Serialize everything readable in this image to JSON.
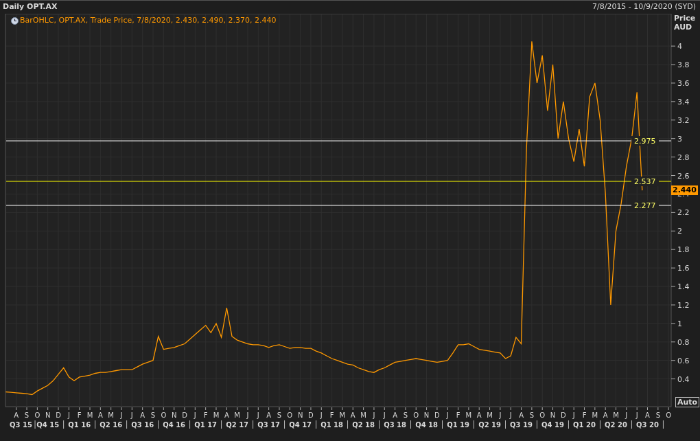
{
  "window": {
    "title": "Daily OPT.AX",
    "date_range": "7/8/2015 - 10/9/2020 (SYD)"
  },
  "legend": {
    "text": "BarOHLC, OPT.AX, Trade Price, 7/8/2020, 2.430, 2.490, 2.370, 2.440"
  },
  "chart": {
    "currency": "AUD",
    "auto_button": "Auto",
    "quarter_labels": [
      "Q3 15",
      "Q4 15",
      "Q1 16",
      "Q2 16",
      "Q3 16",
      "Q4 16",
      "Q1 17",
      "Q2 17",
      "Q3 17",
      "Q4 17",
      "Q1 18",
      "Q2 18",
      "Q3 18",
      "Q4 18",
      "Q1 19",
      "Q2 19",
      "Q3 19",
      "Q4 19",
      "Q1 20",
      "Q2 20",
      "Q3 20"
    ],
    "last_price_tag": "2.440",
    "chart_data": {
      "type": "line",
      "ylabel": "Price",
      "ylim": [
        0.1,
        4.35
      ],
      "yticks": [
        0.4,
        0.6,
        0.8,
        1,
        1.2,
        1.4,
        1.6,
        1.8,
        2,
        2.2,
        2.4,
        2.6,
        2.8,
        3,
        3.2,
        3.4,
        3.6,
        3.8,
        4
      ],
      "categories": [
        null,
        null,
        "A",
        null,
        "S",
        null,
        "O",
        null,
        "N",
        null,
        "D",
        null,
        "J",
        null,
        "F",
        null,
        "M",
        null,
        "A",
        null,
        "M",
        null,
        "J",
        null,
        "J",
        null,
        "A",
        null,
        "S",
        null,
        "O",
        null,
        "N",
        null,
        "D",
        null,
        "J",
        null,
        "F",
        null,
        "M",
        null,
        "A",
        null,
        "M",
        null,
        "J",
        null,
        "J",
        null,
        "A",
        null,
        "S",
        null,
        "O",
        null,
        "N",
        null,
        "D",
        null,
        "J",
        null,
        "F",
        null,
        "M",
        null,
        "A",
        null,
        "M",
        null,
        "J",
        null,
        "J",
        null,
        "A",
        null,
        "S",
        null,
        "O",
        null,
        "N",
        null,
        "D",
        null,
        "J",
        null,
        "F",
        null,
        "M",
        null,
        "A",
        null,
        "M",
        null,
        "J",
        null,
        "J",
        null,
        "A",
        null,
        "S",
        null,
        "O",
        null,
        "N",
        null,
        "D",
        null,
        "J",
        null,
        "F",
        null,
        "M",
        null,
        "A",
        null,
        "M",
        null,
        "J",
        null,
        "J",
        null,
        "A",
        null,
        "S",
        null,
        "O"
      ],
      "series": [
        {
          "color": "#ff9900",
          "values": [
            0.26,
            0.255,
            0.25,
            0.245,
            0.24,
            0.23,
            0.27,
            0.3,
            0.33,
            0.38,
            0.45,
            0.52,
            0.42,
            0.38,
            0.42,
            0.43,
            0.44,
            0.46,
            0.47,
            0.47,
            0.48,
            0.49,
            0.5,
            0.5,
            0.5,
            0.53,
            0.56,
            0.58,
            0.6,
            0.86,
            0.72,
            0.73,
            0.74,
            0.76,
            0.78,
            0.83,
            0.88,
            0.93,
            0.98,
            0.9,
            1.0,
            0.85,
            1.17,
            0.86,
            0.82,
            0.8,
            0.78,
            0.77,
            0.77,
            0.76,
            0.74,
            0.76,
            0.77,
            0.75,
            0.73,
            0.74,
            0.74,
            0.73,
            0.73,
            0.7,
            0.68,
            0.65,
            0.62,
            0.6,
            0.58,
            0.56,
            0.55,
            0.52,
            0.5,
            0.48,
            0.47,
            0.5,
            0.52,
            0.55,
            0.58,
            0.59,
            0.6,
            0.61,
            0.62,
            0.61,
            0.6,
            0.59,
            0.58,
            0.59,
            0.6,
            0.68,
            0.77,
            0.77,
            0.78,
            0.75,
            0.72,
            0.71,
            0.7,
            0.69,
            0.68,
            0.62,
            0.65,
            0.85,
            0.78,
            2.9,
            4.05,
            3.6,
            3.9,
            3.3,
            3.8,
            3.0,
            3.4,
            3.0,
            2.75,
            3.1,
            2.7,
            3.45,
            3.6,
            3.2,
            2.4,
            1.2,
            2.0,
            2.3,
            2.7,
            3.0,
            3.5,
            2.44,
            null,
            null,
            null,
            null,
            null
          ]
        }
      ],
      "grid": true,
      "ref_lines": [
        {
          "axis": "y",
          "value": 2.975,
          "label": "2.975",
          "color": "#ffffff"
        },
        {
          "axis": "y",
          "value": 2.537,
          "label": "2.537",
          "color": "#ffff00"
        },
        {
          "axis": "y",
          "value": 2.277,
          "label": "2.277",
          "color": "#ffffff"
        }
      ]
    }
  }
}
